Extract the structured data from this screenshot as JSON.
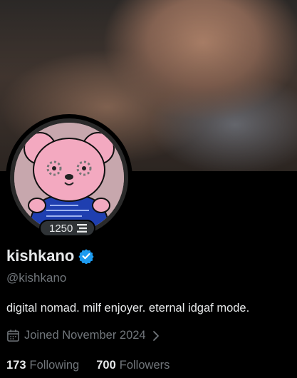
{
  "profile": {
    "display_name": "kishkano",
    "handle": "@kishkano",
    "bio": "digital nomad. milf enjoyer. eternal idgaf mode.",
    "joined": "Joined November 2024",
    "badge_count": "1250",
    "verified": true
  },
  "stats": {
    "following_count": "173",
    "following_label": "Following",
    "followers_count": "700",
    "followers_label": "Followers"
  },
  "icons": {
    "verified": "verified-badge-icon",
    "calendar": "calendar-icon",
    "chevron": "chevron-right-icon",
    "badge": "stacked-lines-icon"
  },
  "colors": {
    "background": "#000000",
    "text_primary": "#e7e9ea",
    "text_secondary": "#71767b",
    "verified_blue": "#1d9bf0",
    "avatar_bg": "#c7a7ad",
    "bear_pink": "#f3a9c0",
    "shirt_blue": "#1f3fb0"
  }
}
